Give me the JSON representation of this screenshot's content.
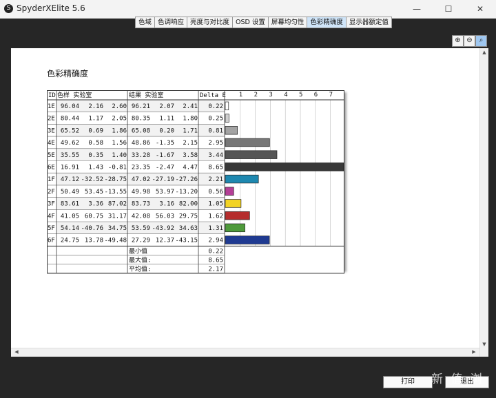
{
  "window": {
    "title": "SpyderXElite 5.6",
    "minimize": "—",
    "maximize": "☐",
    "close": "✕"
  },
  "tabs": [
    "色域",
    "色调响应",
    "亮度与对比度",
    "OSD 设置",
    "屏幕均匀性",
    "色彩精确度",
    "显示器额定值"
  ],
  "active_tab": "色彩精确度",
  "zoom_icons": [
    "zoom-in-icon",
    "zoom-out-icon",
    "zoom-fit-icon"
  ],
  "report": {
    "title": "色彩精确度",
    "headers": {
      "id": "ID",
      "sample": "色样 实验室",
      "result": "结果 实验室",
      "delta": "Delta E"
    },
    "scale_ticks": [
      "1",
      "2",
      "3",
      "4",
      "5",
      "6",
      "7"
    ],
    "rows": [
      {
        "id": "1E",
        "s": [
          "96.04",
          "2.16",
          "2.60"
        ],
        "r": [
          "96.21",
          "2.07",
          "2.41"
        ],
        "de": "0.22",
        "color": "#ffffff"
      },
      {
        "id": "2E",
        "s": [
          "80.44",
          "1.17",
          "2.05"
        ],
        "r": [
          "80.35",
          "1.11",
          "1.80"
        ],
        "de": "0.25",
        "color": "#cfcfcf"
      },
      {
        "id": "3E",
        "s": [
          "65.52",
          "0.69",
          "1.86"
        ],
        "r": [
          "65.08",
          "0.20",
          "1.71"
        ],
        "de": "0.81",
        "color": "#a3a3a3"
      },
      {
        "id": "4E",
        "s": [
          "49.62",
          "0.58",
          "1.56"
        ],
        "r": [
          "48.86",
          "-1.35",
          "2.15"
        ],
        "de": "2.95",
        "color": "#777777"
      },
      {
        "id": "5E",
        "s": [
          "35.55",
          "0.35",
          "1.40"
        ],
        "r": [
          "33.28",
          "-1.67",
          "3.58"
        ],
        "de": "3.44",
        "color": "#555555"
      },
      {
        "id": "6E",
        "s": [
          "16.91",
          "1.43",
          "-0.81"
        ],
        "r": [
          "23.35",
          "-2.47",
          "4.47"
        ],
        "de": "8.65",
        "color": "#383838"
      },
      {
        "id": "1F",
        "s": [
          "47.12",
          "-32.52",
          "-28.75"
        ],
        "r": [
          "47.02",
          "-27.19",
          "-27.26"
        ],
        "de": "2.21",
        "color": "#1e88b0"
      },
      {
        "id": "2F",
        "s": [
          "50.49",
          "53.45",
          "-13.55"
        ],
        "r": [
          "49.98",
          "53.97",
          "-13.20"
        ],
        "de": "0.56",
        "color": "#b43f96"
      },
      {
        "id": "3F",
        "s": [
          "83.61",
          "3.36",
          "87.02"
        ],
        "r": [
          "83.73",
          "3.16",
          "82.00"
        ],
        "de": "1.05",
        "color": "#f2d324"
      },
      {
        "id": "4F",
        "s": [
          "41.05",
          "60.75",
          "31.17"
        ],
        "r": [
          "42.08",
          "56.03",
          "29.75"
        ],
        "de": "1.62",
        "color": "#b52c2c"
      },
      {
        "id": "5F",
        "s": [
          "54.14",
          "-40.76",
          "34.75"
        ],
        "r": [
          "53.59",
          "-43.92",
          "34.63"
        ],
        "de": "1.31",
        "color": "#4e9a3b"
      },
      {
        "id": "6F",
        "s": [
          "24.75",
          "13.78",
          "-49.48"
        ],
        "r": [
          "27.29",
          "12.37",
          "-43.15"
        ],
        "de": "2.94",
        "color": "#1f3a91"
      }
    ],
    "summary": [
      {
        "label": "最小值",
        "value": "0.22"
      },
      {
        "label": "最大值:",
        "value": "8.65"
      },
      {
        "label": "平均值:",
        "value": "2.17"
      }
    ]
  },
  "buttons": {
    "print": "打印",
    "exit": "退出"
  },
  "watermark": "新 值 浏"
}
